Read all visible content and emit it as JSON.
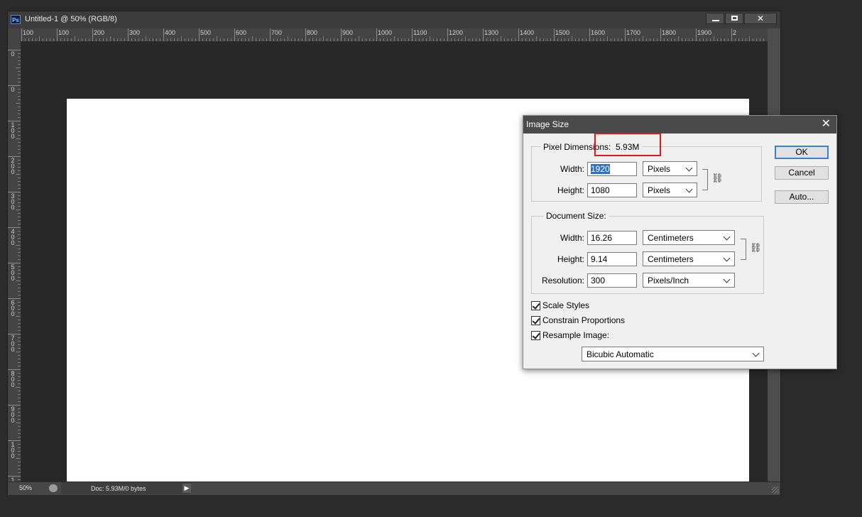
{
  "document_window": {
    "app_icon": "Ps",
    "title": "Untitled-1 @ 50% (RGB/8)",
    "minimize_label": "",
    "maximize_label": "",
    "close_label": "✕",
    "ruler_h_labels": [
      "100",
      "100",
      "200",
      "300",
      "400",
      "500",
      "600",
      "700",
      "800",
      "900",
      "1000",
      "1100",
      "1200",
      "1300",
      "1400",
      "1500",
      "1600",
      "1700",
      "1800",
      "1900",
      "2"
    ],
    "ruler_v_labels": [
      "0",
      "0",
      "1\n0\n0",
      "2\n0\n0",
      "3\n0\n0",
      "4\n0\n0",
      "5\n0\n0",
      "6\n0\n0",
      "7\n0\n0",
      "8\n0\n0",
      "9\n0\n0",
      "1\n0\n0",
      "1"
    ],
    "status": {
      "zoom": "50%",
      "doc_info": "Doc: 5.93M/0 bytes",
      "arrow_icon": "play-arrow-icon"
    }
  },
  "dialog": {
    "title": "Image Size",
    "close_icon": "close-icon",
    "pixel_dimensions": {
      "legend": "Pixel Dimensions:",
      "size": "5.93M",
      "width_label": "Width:",
      "width_value": "1920",
      "width_unit": "Pixels",
      "height_label": "Height:",
      "height_value": "1080",
      "height_unit": "Pixels"
    },
    "document_size": {
      "legend": "Document Size:",
      "width_label": "Width:",
      "width_value": "16.26",
      "width_unit": "Centimeters",
      "height_label": "Height:",
      "height_value": "9.14",
      "height_unit": "Centimeters",
      "resolution_label": "Resolution:",
      "resolution_value": "300",
      "resolution_unit": "Pixels/Inch"
    },
    "checkboxes": {
      "scale_styles": "Scale Styles",
      "constrain_proportions": "Constrain Proportions",
      "resample_image": "Resample Image:"
    },
    "resample_method": "Bicubic Automatic",
    "buttons": {
      "ok": "OK",
      "cancel": "Cancel",
      "auto": "Auto..."
    },
    "highlight_color": "#e8161b"
  }
}
